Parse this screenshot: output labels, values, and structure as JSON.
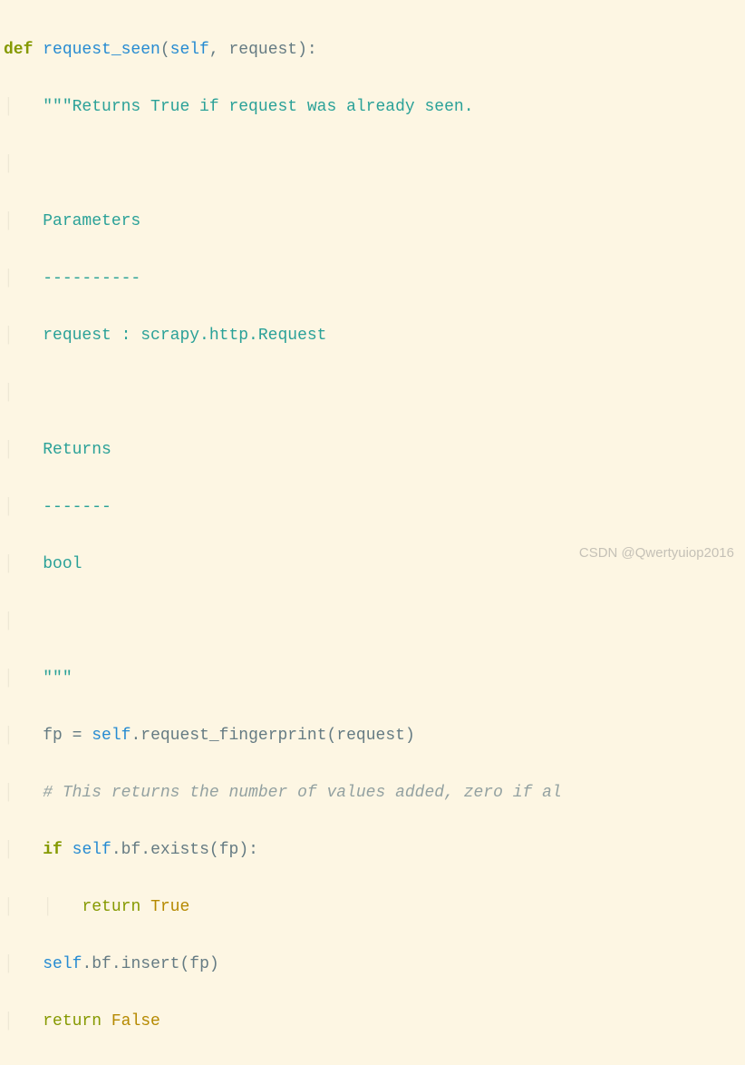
{
  "code": {
    "def": "def",
    "func_name": "request_seen",
    "self": "self",
    "param_request": "request",
    "doc_open": "\"\"\"",
    "doc_l1": "Returns True if request was already seen.",
    "doc_l2": "Parameters",
    "doc_l3": "----------",
    "doc_l4": "request : scrapy.http.Request",
    "doc_l5": "Returns",
    "doc_l6": "-------",
    "doc_l7": "bool",
    "doc_close": "\"\"\"",
    "var_fp": "fp",
    "eq": " = ",
    "dot": ".",
    "m_fingerprint": "request_fingerprint",
    "lp": "(",
    "rp": ")",
    "colon": ":",
    "comma": ", ",
    "comment1": "# This returns the number of values added, zero if al",
    "if": "if",
    "attr_bf": "bf",
    "m_exists": "exists",
    "return": "return",
    "true": "True",
    "m_insert": "insert",
    "false": "False"
  },
  "watermark": "CSDN @Qwertyuiop2016"
}
